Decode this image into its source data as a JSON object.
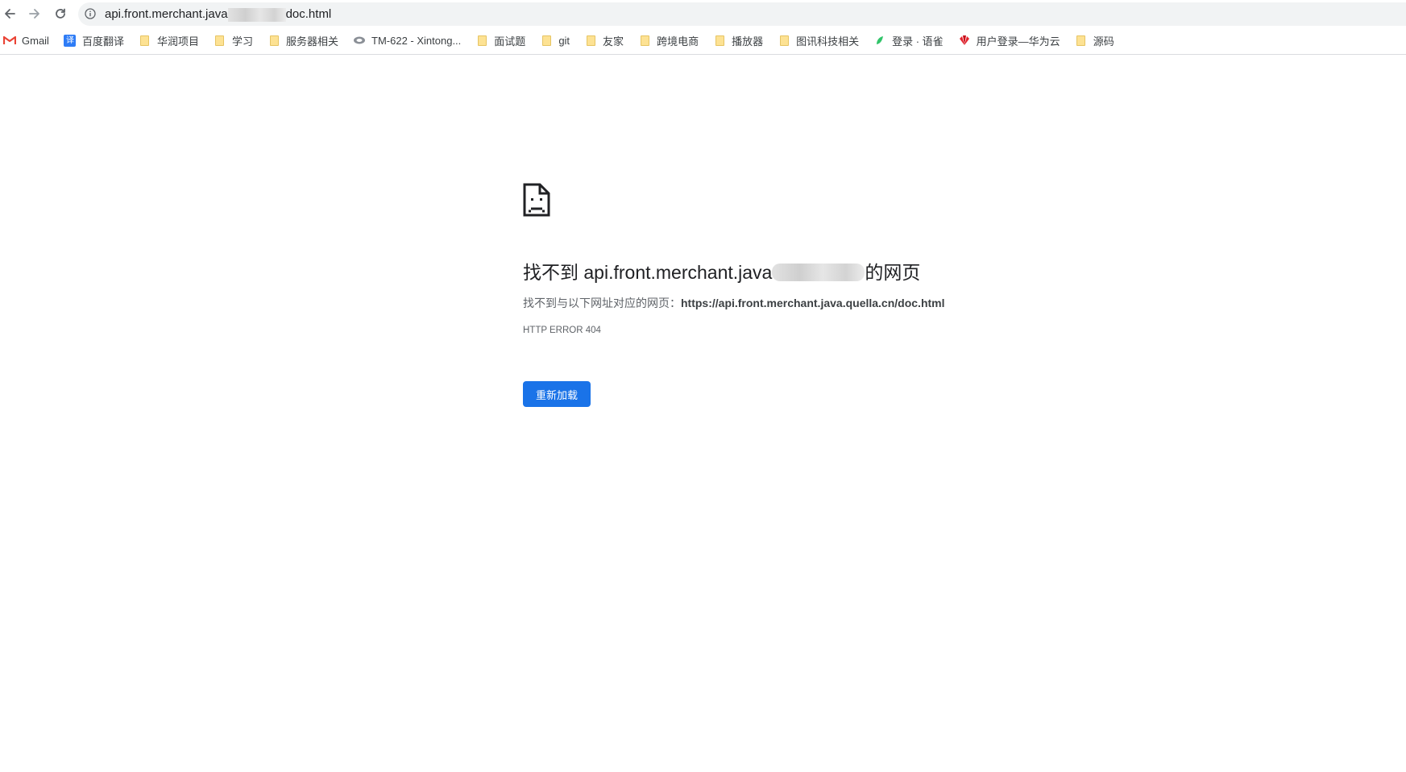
{
  "browser": {
    "url_prefix": "api.front.merchant.java",
    "url_suffix": "doc.html"
  },
  "bookmarks": [
    {
      "label": "Gmail",
      "icon": "gmail-icon"
    },
    {
      "label": "百度翻译",
      "icon": "translate-icon"
    },
    {
      "label": "华润项目",
      "icon": "folder-icon"
    },
    {
      "label": "学习",
      "icon": "folder-icon"
    },
    {
      "label": "服务器相关",
      "icon": "folder-icon"
    },
    {
      "label": "TM-622 - Xintong...",
      "icon": "jira-icon"
    },
    {
      "label": "面试题",
      "icon": "folder-icon"
    },
    {
      "label": "git",
      "icon": "folder-icon"
    },
    {
      "label": "友家",
      "icon": "folder-icon"
    },
    {
      "label": "跨境电商",
      "icon": "folder-icon"
    },
    {
      "label": "播放器",
      "icon": "folder-icon"
    },
    {
      "label": "图讯科技相关",
      "icon": "folder-icon"
    },
    {
      "label": "登录 · 语雀",
      "icon": "yuque-icon"
    },
    {
      "label": "用户登录—华为云",
      "icon": "huawei-icon"
    },
    {
      "label": "源码",
      "icon": "folder-icon"
    }
  ],
  "error_page": {
    "title_prefix": "找不到 api.front.merchant.java",
    "title_suffix": "的网页",
    "description_prefix": "找不到与以下网址对应的网页：",
    "description_url": "https://api.front.merchant.java.quella.cn/doc.html",
    "error_code": "HTTP ERROR 404",
    "reload_label": "重新加载"
  },
  "colors": {
    "accent": "#1a73e8",
    "folder": "#fde293"
  }
}
